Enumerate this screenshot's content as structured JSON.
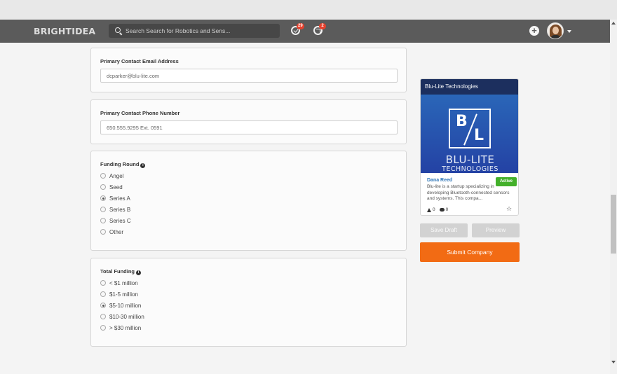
{
  "navbar": {
    "logo": "BRIGHTIDEA",
    "search_placeholder": "Search Search for Robotics and Sens...",
    "notifications": {
      "check_count": "29",
      "refresh_count": "2"
    },
    "plus_label": "+"
  },
  "form": {
    "email": {
      "label": "Primary Contact Email Address",
      "value": "dcparker@blu-lite.com"
    },
    "phone": {
      "label": "Primary Contact Phone Number",
      "value": "650.555.9295 Ext. 0591"
    },
    "funding_round": {
      "label": "Funding Round",
      "options": [
        "Angel",
        "Seed",
        "Series A",
        "Series B",
        "Series C",
        "Other"
      ],
      "selected": "Series A"
    },
    "total_funding": {
      "label": "Total Funding",
      "options": [
        "< $1 million",
        "$1-5 million",
        "$5-10 million",
        "$10-30 million",
        "> $30 million"
      ],
      "selected": "$5-10 million"
    },
    "info_glyph": "i"
  },
  "card": {
    "title": "Blu-Lite Technologies",
    "logo_letters": {
      "b": "B",
      "l": "L"
    },
    "brand_line1": "BLU-LITE",
    "brand_line2": "TECHNOLOGIES",
    "status": "Active",
    "author": "Dana Reed",
    "description": "Blu-lite is a startup specializing in developing Bluetooth-connected sensors and systems. This compa...",
    "votes": "0",
    "comments": "0",
    "star_glyph": "☆"
  },
  "actions": {
    "save_draft": "Save Draft",
    "preview": "Preview",
    "submit": "Submit Company"
  }
}
